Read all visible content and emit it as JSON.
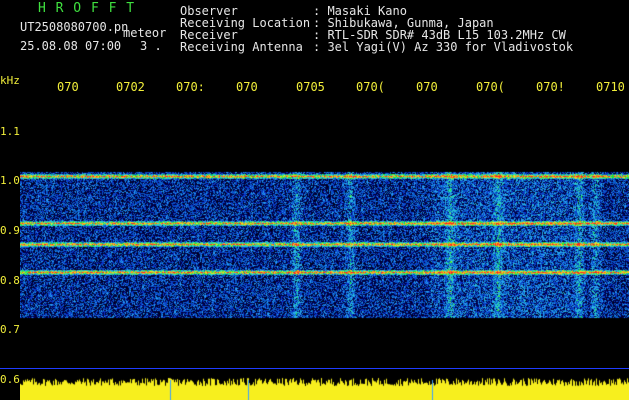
{
  "header": {
    "station_name": "H R O F F T",
    "filename": "UT2508080700.pn",
    "mode": "meteor",
    "datetime": "25.08.08 07:00",
    "count": "3 .",
    "fields": [
      {
        "label": "Observer",
        "value": ": Masaki Kano"
      },
      {
        "label": "Receiving Location",
        "value": ": Shibukawa, Gunma, Japan"
      },
      {
        "label": "Receiver",
        "value": ": RTL-SDR SDR# 43dB L15 103.2MHz CW"
      },
      {
        "label": "Receiving Antenna",
        "value": ": 3el Yagi(V) Az 330 for Vladivostok"
      }
    ]
  },
  "time_ticks": [
    "070",
    "0702",
    "070:",
    "070",
    "0705",
    "070(",
    "070",
    "070(",
    "070!",
    "0710"
  ],
  "freq_axis": {
    "unit": "kHz",
    "labels": [
      "1.1",
      "1.0",
      "0.9",
      "0.8",
      "0.7",
      "0.6"
    ]
  },
  "colors": {
    "background": "#000000",
    "band": "#1a2cd8",
    "noise_mid": "#34a8ff",
    "hot": "#ff2a2a",
    "amplitude": "#f7ef1e",
    "separator": "#1f3cff"
  }
}
